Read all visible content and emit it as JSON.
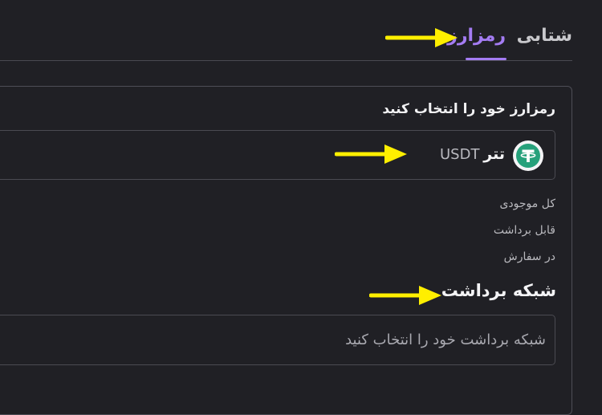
{
  "tabs": [
    {
      "label": "شتابی",
      "active": false
    },
    {
      "label": "رمزارز",
      "active": true
    }
  ],
  "colors": {
    "accent": "#a47cf3",
    "background": "#202025",
    "annotation_arrow": "#ffef00",
    "coin_brand": "#26a17b"
  },
  "coin_select": {
    "label": "رمزارز خود را انتخاب کنید",
    "selected_name": "تتر",
    "selected_symbol": "USDT",
    "icon": "tether-icon"
  },
  "balances": {
    "total_label": "کل موجودی",
    "withdrawable_label": "قابل برداشت",
    "in_orders_label": "در سفارش"
  },
  "network": {
    "label": "شبکه برداشت",
    "placeholder": "شبکه برداشت خود را انتخاب کنید"
  },
  "annotations": [
    "arrow-to-crypto-tab",
    "arrow-to-coin",
    "arrow-to-network"
  ]
}
